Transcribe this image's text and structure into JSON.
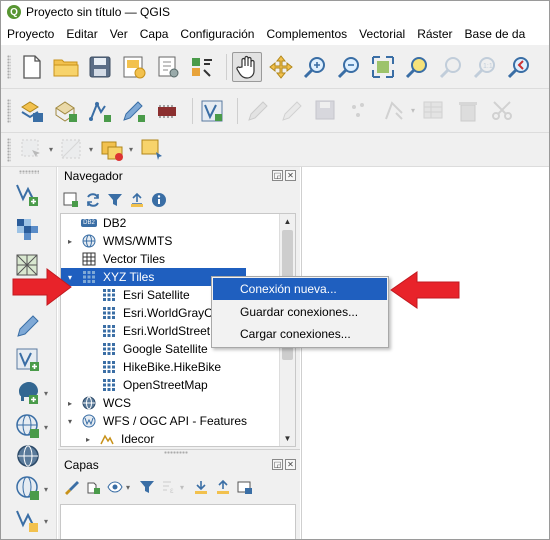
{
  "window": {
    "title": "Proyecto sin título — QGIS",
    "logo_letter": "Q"
  },
  "menubar": {
    "items": [
      "Proyecto",
      "Editar",
      "Ver",
      "Capa",
      "Configuración",
      "Complementos",
      "Vectorial",
      "Ráster",
      "Base de da"
    ]
  },
  "browser_panel": {
    "title": "Navegador",
    "tree": [
      {
        "label": "DB2",
        "icon": "db2-icon",
        "icon_text": "DB2",
        "expander": ""
      },
      {
        "label": "WMS/WMTS",
        "icon": "wms-globe-icon",
        "expander": "▸"
      },
      {
        "label": "Vector Tiles",
        "icon": "vector-tiles-icon",
        "expander": ""
      },
      {
        "label": "XYZ Tiles",
        "icon": "xyz-tiles-icon",
        "expander": "▾",
        "selected": true
      },
      {
        "label": "Esri Satellite",
        "icon": "tile-grid-icon",
        "expander": ""
      },
      {
        "label": "Esri.WorldGrayC",
        "icon": "tile-grid-icon",
        "expander": ""
      },
      {
        "label": "Esri.WorldStreet",
        "icon": "tile-grid-icon",
        "expander": ""
      },
      {
        "label": "Google Satellite",
        "icon": "tile-grid-icon",
        "expander": ""
      },
      {
        "label": "HikeBike.HikeBike",
        "icon": "tile-grid-icon",
        "expander": ""
      },
      {
        "label": "OpenStreetMap",
        "icon": "tile-grid-icon",
        "expander": ""
      },
      {
        "label": "WCS",
        "icon": "wcs-globe-icon",
        "expander": "▸"
      },
      {
        "label": "WFS / OGC API - Features",
        "icon": "wfs-globe-icon",
        "expander": "▾"
      },
      {
        "label": "Idecor",
        "icon": "wfs-layer-icon",
        "expander": "▸"
      }
    ]
  },
  "layers_panel": {
    "title": "Capas"
  },
  "context_menu": {
    "items": [
      {
        "label": "Conexión nueva...",
        "highlighted": true
      },
      {
        "label": "Guardar conexiones...",
        "highlighted": false
      },
      {
        "label": "Cargar conexiones...",
        "highlighted": false
      }
    ]
  },
  "colors": {
    "selection": "#1f5fbf",
    "annotation_arrow": "#e8232a",
    "qgis_green": "#589632"
  }
}
